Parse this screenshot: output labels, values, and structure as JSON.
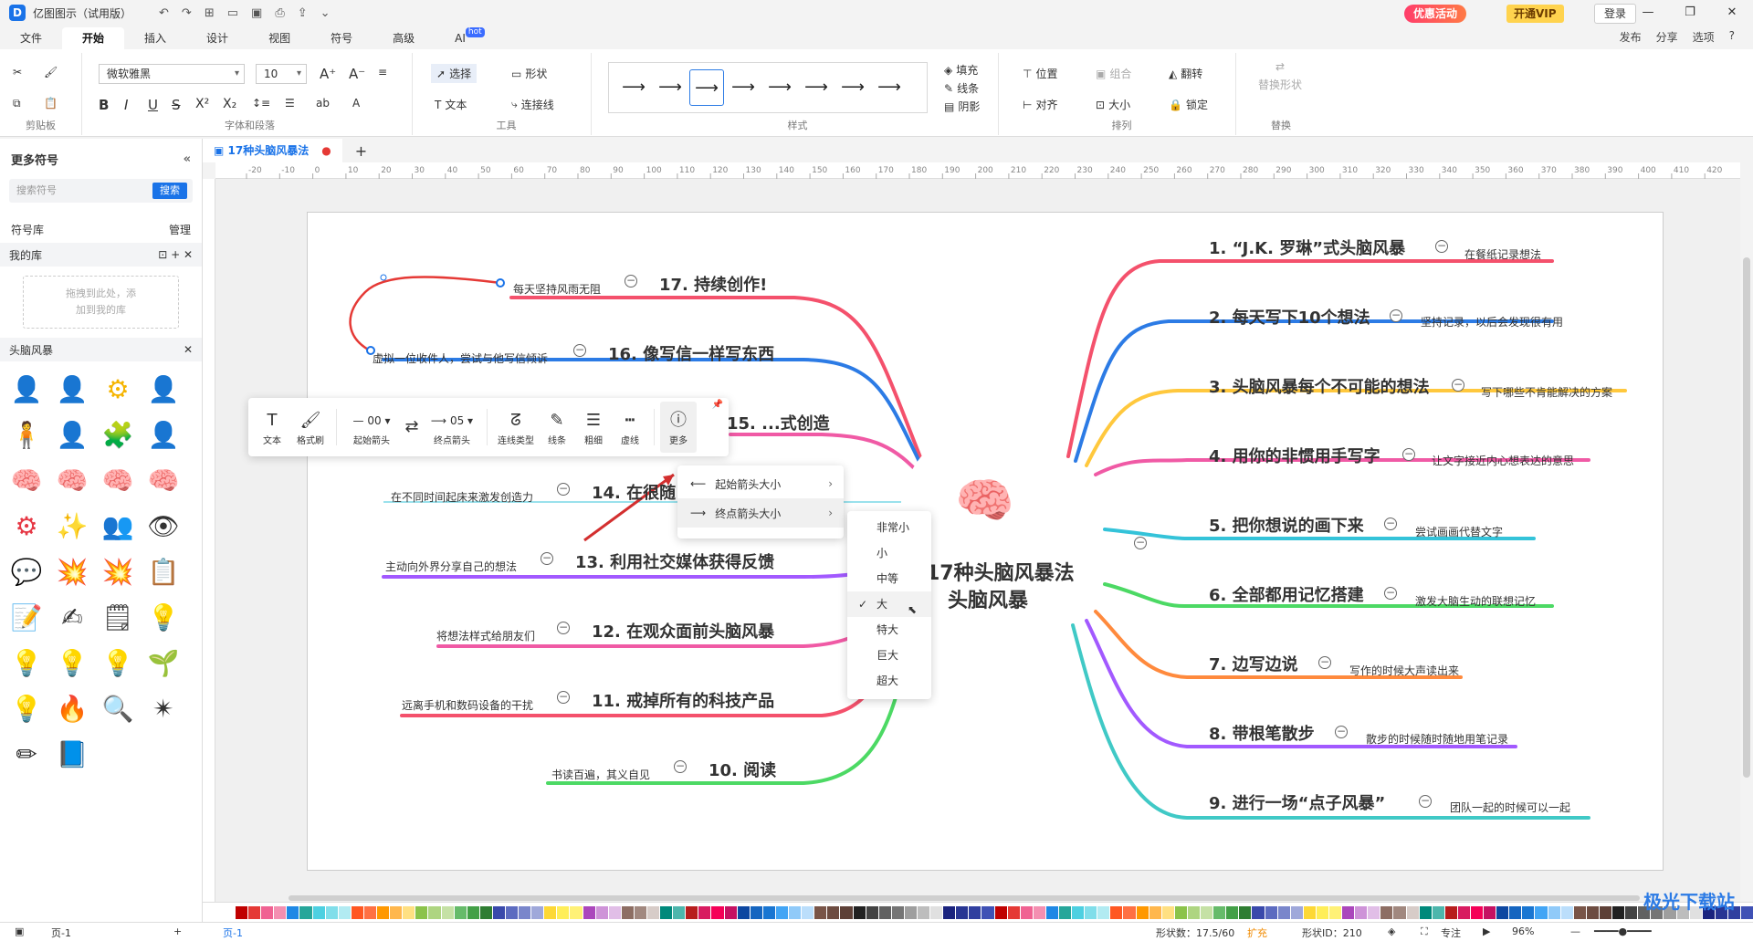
{
  "app": {
    "title": "亿图图示（试用版）",
    "logo": "D",
    "promo": "优惠活动",
    "vip": "开通VIP",
    "login": "登录"
  },
  "menubar": {
    "tabs": [
      "文件",
      "开始",
      "插入",
      "设计",
      "视图",
      "符号",
      "高级",
      "AI"
    ],
    "ai_badge": "hot",
    "active": "开始",
    "right": [
      "发布",
      "分享",
      "选项",
      "?"
    ]
  },
  "ribbon": {
    "clipboard": {
      "label": "剪贴板"
    },
    "font": {
      "label": "字体和段落",
      "family": "微软雅黑",
      "size": "10"
    },
    "tools": {
      "label": "工具",
      "select": "选择",
      "text": "文本",
      "shape": "形状",
      "connector": "连接线"
    },
    "style": {
      "label": "样式",
      "fill": "填充",
      "line": "线条",
      "shadow": "阴影"
    },
    "arrange": {
      "label": "排列",
      "position": "位置",
      "group": "组合",
      "flip": "翻转",
      "align": "对齐",
      "size": "大小",
      "lock": "锁定"
    },
    "replace": {
      "label": "替换",
      "replace_shape": "替换形状"
    }
  },
  "left_panel": {
    "title": "更多符号",
    "search_placeholder": "搜索符号",
    "search_btn": "搜索",
    "library": "符号库",
    "manage": "管理",
    "my_library": "我的库",
    "dropzone": [
      "拖拽到此处，添",
      "加到我的库"
    ],
    "category": "头脑风暴"
  },
  "document": {
    "tab": "17种头脑风暴法"
  },
  "ruler": [
    "-20",
    "-10",
    "0",
    "10",
    "20",
    "30",
    "40",
    "50",
    "60",
    "70",
    "80",
    "90",
    "100",
    "110",
    "120",
    "130",
    "140",
    "150",
    "160",
    "170",
    "180",
    "190",
    "200",
    "210",
    "220",
    "230",
    "240",
    "250",
    "260",
    "270",
    "280",
    "290",
    "300",
    "310",
    "320",
    "330",
    "340",
    "350",
    "360",
    "370",
    "380",
    "390",
    "400",
    "410",
    "420"
  ],
  "mindmap": {
    "center": [
      "17种头脑风暴法",
      "头脑风暴"
    ],
    "right": [
      {
        "title": "1. “J.K. 罗琳”式头脑风暴",
        "note": "在餐纸记录想法",
        "color": "#f4516c"
      },
      {
        "title": "2. 每天写下10个想法",
        "note": "坚持记录，以后会发现很有用",
        "color": "#2c7be5"
      },
      {
        "title": "3. 头脑风暴每个不可能的想法",
        "note": "写下哪些不肯能解决的方案",
        "color": "#ffc83d"
      },
      {
        "title": "4. 用你的非惯用手写字",
        "note": "让文字接近内心想表达的意思",
        "color": "#f05aa5"
      },
      {
        "title": "5. 把你想说的画下来",
        "note": "尝试画画代替文字",
        "color": "#34c3d9"
      },
      {
        "title": "6. 全部都用记忆搭建",
        "note": "激发大脑生动的联想记忆",
        "color": "#4cd964"
      },
      {
        "title": "7. 边写边说",
        "note": "写作的时候大声读出来",
        "color": "#ff8a3d"
      },
      {
        "title": "8. 带根笔散步",
        "note": "散步的时候随时随地用笔记录",
        "color": "#a259ff"
      },
      {
        "title": "9. 进行一场“点子风暴”",
        "note": "团队一起的时候可以一起",
        "color": "#40c9c6"
      }
    ],
    "left": [
      {
        "title": "17. 持续创作!",
        "note": "每天坚持风雨无阻",
        "color": "#f4516c"
      },
      {
        "title": "16. 像写信一样写东西",
        "note": "虚拟一位收件人，尝试与他写信倾诉",
        "color": "#2c7be5"
      },
      {
        "title": "15. ...式创造",
        "note": "",
        "color": "#f05aa5"
      },
      {
        "title": "14. 在很随...",
        "note": "在不同时间起床来激发创造力",
        "color": "#34c3d9"
      },
      {
        "title": "13. 利用社交媒体获得反馈",
        "note": "主动向外界分享自己的想法",
        "color": "#a259ff"
      },
      {
        "title": "12. 在观众面前头脑风暴",
        "note": "将想法样式给朋友们",
        "color": "#f05aa5"
      },
      {
        "title": "11. 戒掉所有的科技产品",
        "note": "远离手机和数码设备的干扰",
        "color": "#f4516c"
      },
      {
        "title": "10. 阅读",
        "note": "书读百遍，其义自见",
        "color": "#4cd964"
      }
    ]
  },
  "float_toolbar": {
    "items": [
      "文本",
      "格式刷",
      "起始箭头",
      "终点箭头",
      "连线类型",
      "线条",
      "粗细",
      "虚线",
      "更多"
    ],
    "start_val": "00",
    "end_val": "05"
  },
  "context_menu": {
    "items": [
      "起始箭头大小",
      "终点箭头大小"
    ]
  },
  "arrow_size_menu": {
    "items": [
      "非常小",
      "小",
      "中等",
      "大",
      "特大",
      "巨大",
      "超大"
    ],
    "selected": "大"
  },
  "status": {
    "page": "页-1",
    "page_tab": "页-1",
    "shape_count": "形状数：17.5/60",
    "expand": "扩充",
    "shape_id": "形状ID：210",
    "focus": "专注",
    "zoom": "96%"
  },
  "watermark": "极光下载站"
}
